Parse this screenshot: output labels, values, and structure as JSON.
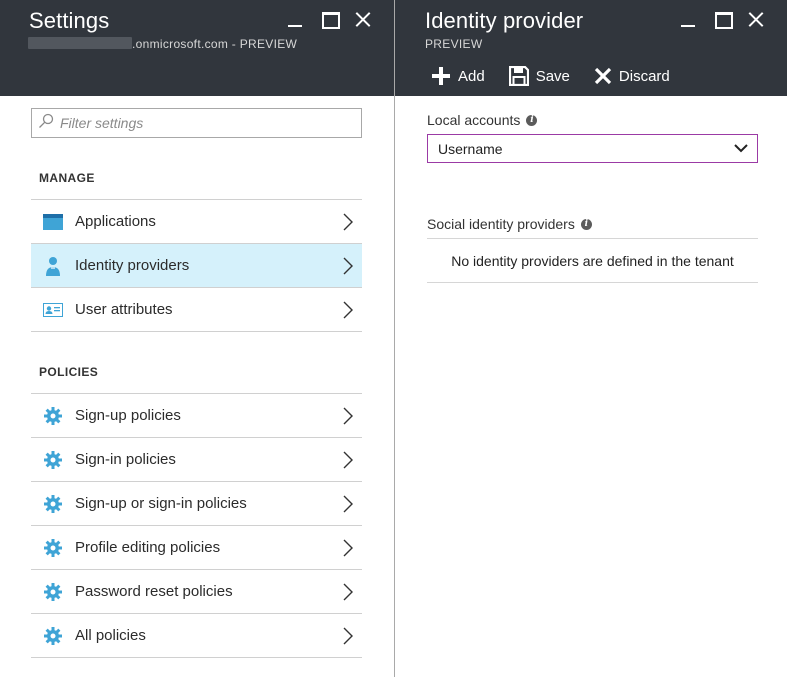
{
  "left_blade": {
    "title": "Settings",
    "subtitle_domain": ".onmicrosoft.com - PREVIEW",
    "filter_placeholder": "Filter settings",
    "manage_section": "MANAGE",
    "manage_items": [
      {
        "label": "Applications",
        "icon": "applications-icon",
        "active": false
      },
      {
        "label": "Identity providers",
        "icon": "identity-providers-icon",
        "active": true
      },
      {
        "label": "User attributes",
        "icon": "user-attributes-icon",
        "active": false
      }
    ],
    "policies_section": "POLICIES",
    "policy_items": [
      {
        "label": "Sign-up policies",
        "icon": "gear-icon"
      },
      {
        "label": "Sign-in policies",
        "icon": "gear-icon"
      },
      {
        "label": "Sign-up or sign-in policies",
        "icon": "gear-icon"
      },
      {
        "label": "Profile editing policies",
        "icon": "gear-icon"
      },
      {
        "label": "Password reset policies",
        "icon": "gear-icon"
      },
      {
        "label": "All policies",
        "icon": "gear-icon"
      }
    ]
  },
  "right_blade": {
    "title": "Identity provider",
    "subtitle": "PREVIEW",
    "toolbar": {
      "add_label": "Add",
      "save_label": "Save",
      "discard_label": "Discard"
    },
    "local_accounts_label": "Local accounts",
    "local_accounts_value": "Username",
    "social_label": "Social identity providers",
    "social_empty_text": "No identity providers are defined in the tenant"
  },
  "colors": {
    "header_bg": "#31363d",
    "active_item_bg": "#d5f1fb",
    "icon_blue": "#3fa4d6",
    "select_border": "#9b3aa5"
  }
}
